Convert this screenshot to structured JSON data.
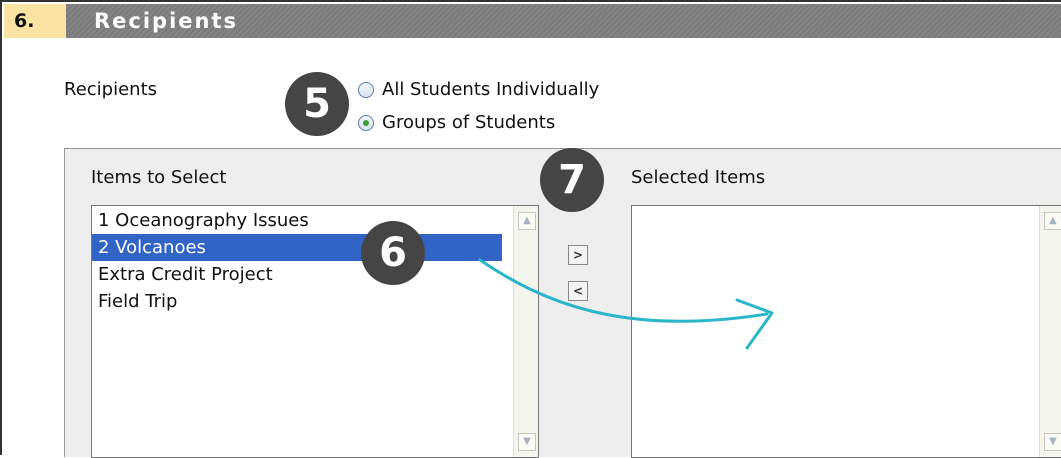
{
  "section": {
    "number": "6.",
    "title": "Recipients"
  },
  "recipients": {
    "label": "Recipients",
    "options": [
      {
        "label": "All Students Individually",
        "checked": false
      },
      {
        "label": "Groups of Students",
        "checked": true
      }
    ]
  },
  "items_to_select": {
    "label": "Items to Select",
    "items": [
      "1 Oceanography Issues",
      "2 Volcanoes",
      "Extra Credit Project",
      "Field Trip"
    ],
    "selected_index": 1
  },
  "selected_items": {
    "label": "Selected Items",
    "items": []
  },
  "buttons": {
    "move_right": ">",
    "move_left": "<"
  },
  "callouts": {
    "c5": "5",
    "c6": "6",
    "c7": "7"
  },
  "colors": {
    "header_bg": "#7a7a7a",
    "step_bg": "#fbe3a4",
    "selection": "#3164c5",
    "callout": "#454545",
    "arrow": "#2bb5c9"
  }
}
